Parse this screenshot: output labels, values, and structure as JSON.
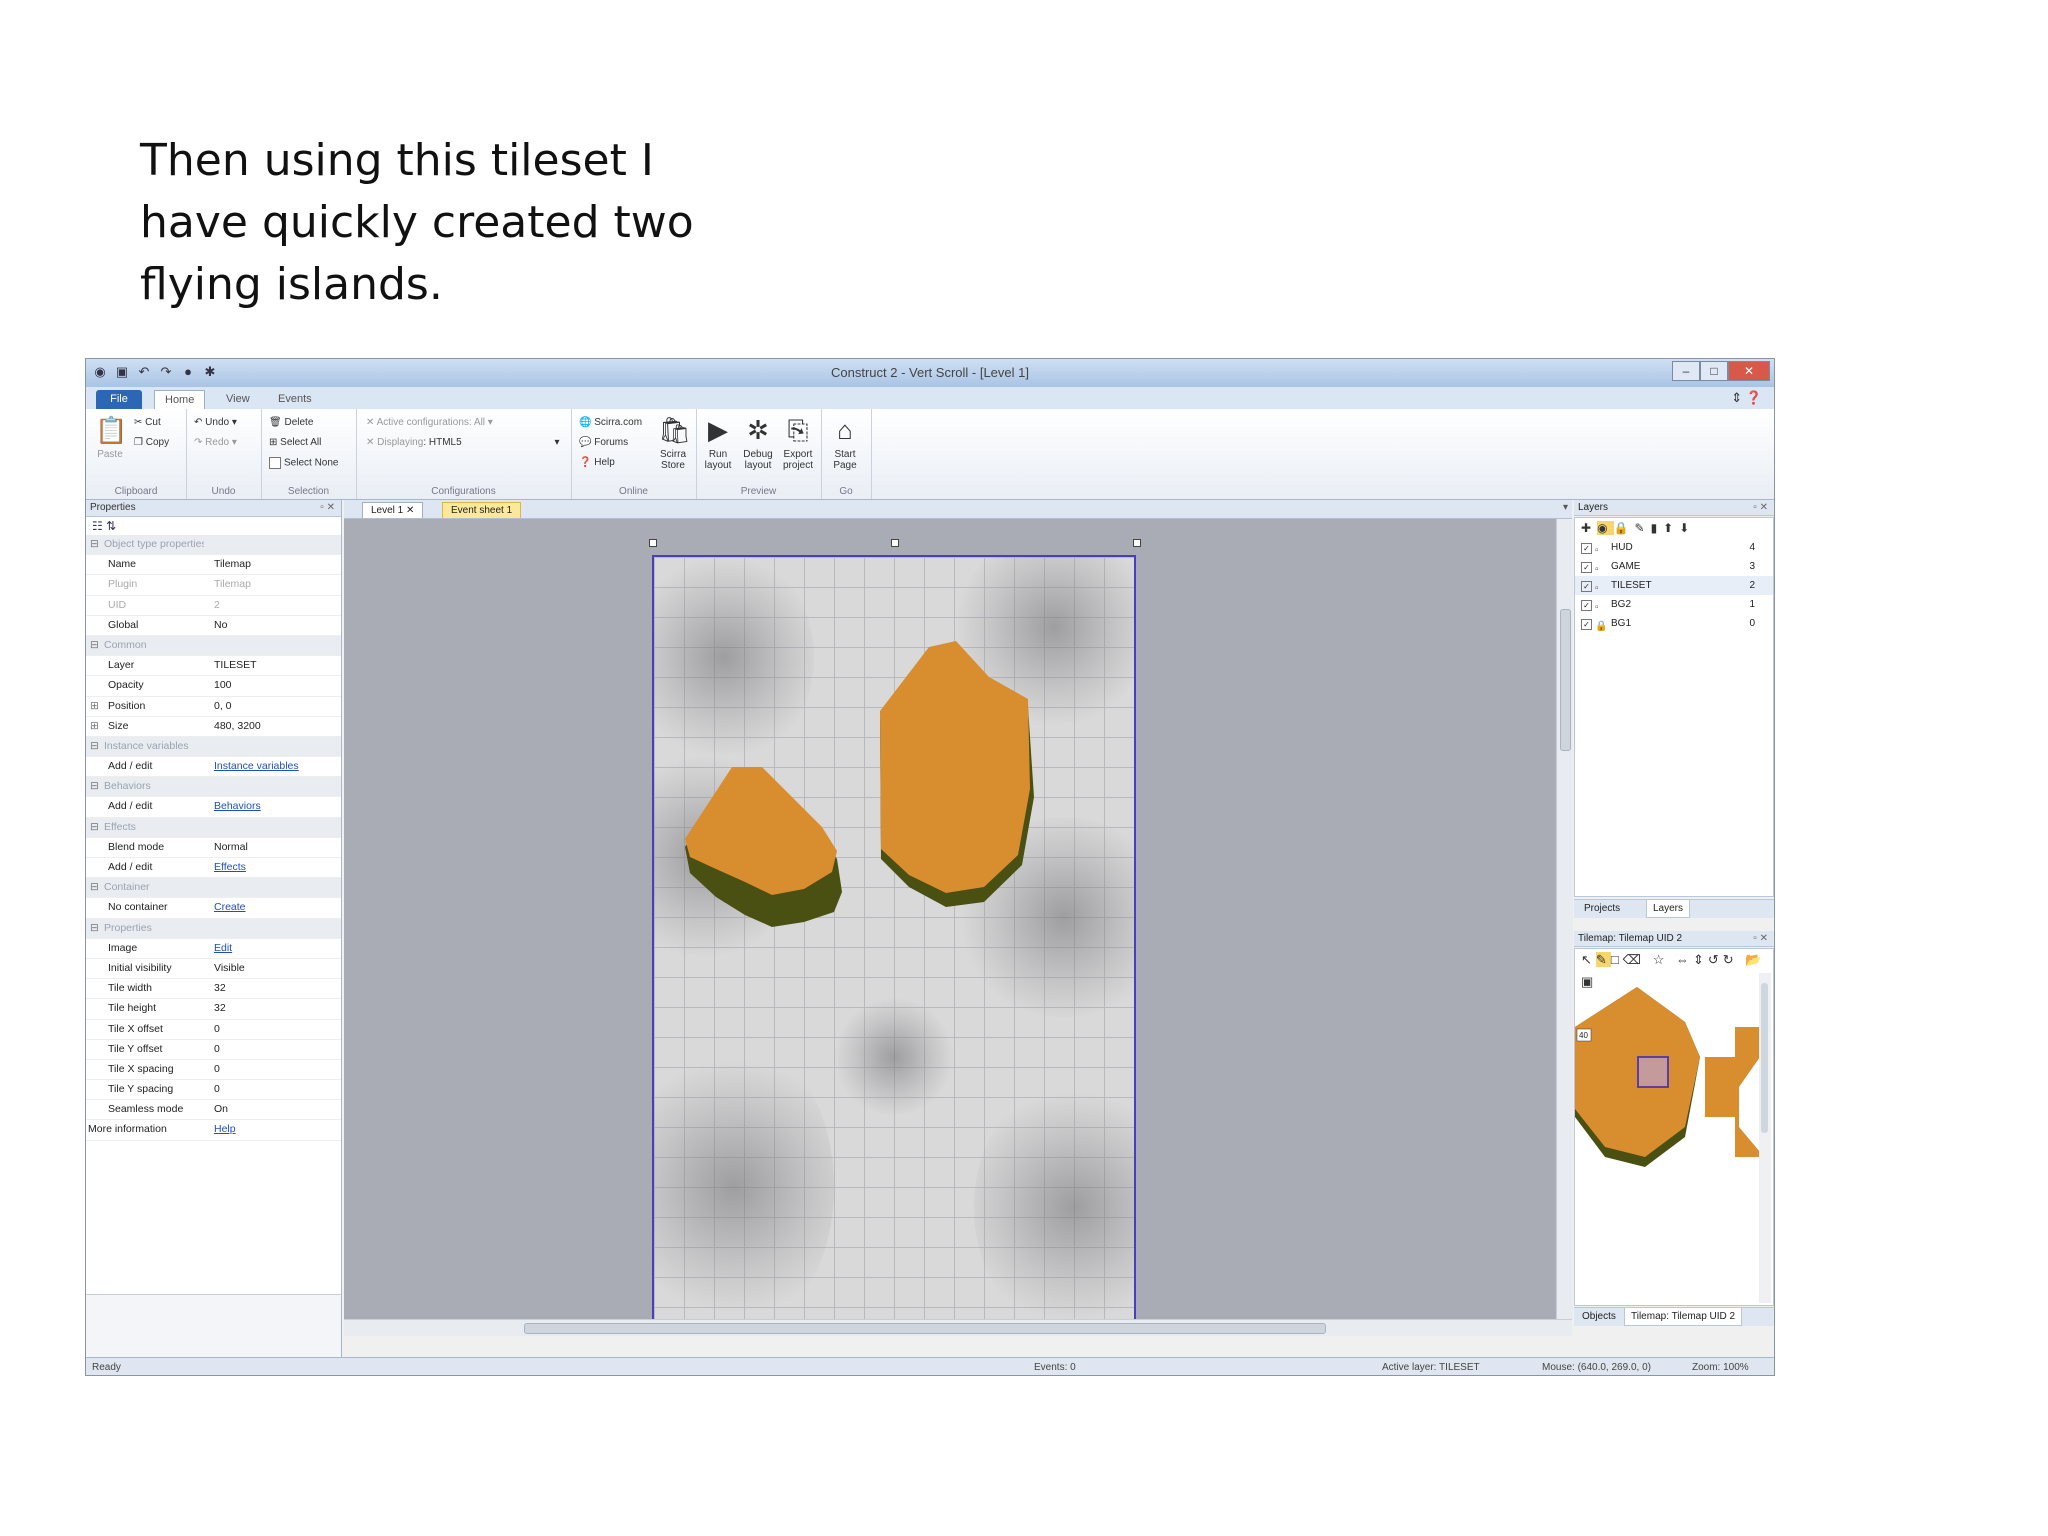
{
  "caption": {
    "line1": "Then using this tileset I",
    "line2": "have quickly created two",
    "line3": "flying islands."
  },
  "window": {
    "title": "Construct 2 - Vert Scroll - [Level 1]"
  },
  "ribbon_tabs": {
    "file": "File",
    "home": "Home",
    "view": "View",
    "events": "Events"
  },
  "ribbon": {
    "clipboard": {
      "paste": "Paste",
      "cut": "Cut",
      "copy": "Copy",
      "label": "Clipboard"
    },
    "undo": {
      "undo": "Undo",
      "redo": "Redo",
      "label": "Undo"
    },
    "selection": {
      "delete": "Delete",
      "select_all": "Select All",
      "select_none": "Select None",
      "label": "Selection"
    },
    "configurations": {
      "active_label": "Active configurations",
      "active_value": "All",
      "display_label": "Displaying",
      "display_value": "HTML5",
      "label": "Configurations"
    },
    "online": {
      "scirra": "Scirra.com",
      "forums": "Forums",
      "help": "Help",
      "store_line1": "Scirra",
      "store_line2": "Store",
      "label": "Online"
    },
    "preview": {
      "run_line1": "Run",
      "run_line2": "layout",
      "debug_line1": "Debug",
      "debug_line2": "layout",
      "export_line1": "Export",
      "export_line2": "project",
      "label": "Preview"
    },
    "go": {
      "start_line1": "Start",
      "start_line2": "Page",
      "label": "Go"
    }
  },
  "properties": {
    "title": "Properties",
    "rows": [
      {
        "kind": "cat",
        "k": "Object type properties"
      },
      {
        "kind": "row",
        "k": "Name",
        "v": "Tilemap"
      },
      {
        "kind": "dim",
        "k": "Plugin",
        "v": "Tilemap"
      },
      {
        "kind": "dim",
        "k": "UID",
        "v": "2"
      },
      {
        "kind": "row",
        "k": "Global",
        "v": "No"
      },
      {
        "kind": "cat",
        "k": "Common"
      },
      {
        "kind": "row",
        "k": "Layer",
        "v": "TILESET"
      },
      {
        "kind": "row",
        "k": "Opacity",
        "v": "100"
      },
      {
        "kind": "exp",
        "k": "Position",
        "v": "0, 0"
      },
      {
        "kind": "exp",
        "k": "Size",
        "v": "480, 3200"
      },
      {
        "kind": "cat",
        "k": "Instance variables"
      },
      {
        "kind": "link",
        "k": "Add / edit",
        "v": "Instance variables"
      },
      {
        "kind": "cat",
        "k": "Behaviors"
      },
      {
        "kind": "link",
        "k": "Add / edit",
        "v": "Behaviors"
      },
      {
        "kind": "cat",
        "k": "Effects"
      },
      {
        "kind": "row",
        "k": "Blend mode",
        "v": "Normal"
      },
      {
        "kind": "link",
        "k": "Add / edit",
        "v": "Effects"
      },
      {
        "kind": "cat",
        "k": "Container"
      },
      {
        "kind": "link",
        "k": "No container",
        "v": "Create"
      },
      {
        "kind": "cat",
        "k": "Properties"
      },
      {
        "kind": "link",
        "k": "Image",
        "v": "Edit"
      },
      {
        "kind": "row",
        "k": "Initial visibility",
        "v": "Visible"
      },
      {
        "kind": "row",
        "k": "Tile width",
        "v": "32"
      },
      {
        "kind": "row",
        "k": "Tile height",
        "v": "32"
      },
      {
        "kind": "row",
        "k": "Tile X offset",
        "v": "0"
      },
      {
        "kind": "row",
        "k": "Tile Y offset",
        "v": "0"
      },
      {
        "kind": "row",
        "k": "Tile X spacing",
        "v": "0"
      },
      {
        "kind": "row",
        "k": "Tile Y spacing",
        "v": "0"
      },
      {
        "kind": "row",
        "k": "Seamless mode",
        "v": "On"
      },
      {
        "kind": "linktop",
        "k": "More information",
        "v": "Help"
      }
    ]
  },
  "doc_tabs": {
    "layout": "Level 1",
    "events": "Event sheet 1"
  },
  "layers": {
    "title": "Layers",
    "items": [
      {
        "name": "HUD",
        "index": "4"
      },
      {
        "name": "GAME",
        "index": "3"
      },
      {
        "name": "TILESET",
        "index": "2"
      },
      {
        "name": "BG2",
        "index": "1"
      },
      {
        "name": "BG1",
        "index": "0"
      }
    ],
    "tab_projects": "Projects",
    "tab_layers": "Layers"
  },
  "tilemap_bar": {
    "title": "Tilemap: Tilemap UID 2",
    "tile_number": "40"
  },
  "bottom_tabs": {
    "objects": "Objects",
    "tilemap": "Tilemap: Tilemap UID 2"
  },
  "status": {
    "ready": "Ready",
    "events": "Events: 0",
    "active_layer": "Active layer: TILESET",
    "mouse": "Mouse: (640.0, 269.0, 0)",
    "zoom": "Zoom: 100%"
  },
  "colors": {
    "island_fill": "#d88d2f",
    "island_edge": "#5a5a1a",
    "layout_border": "#4a3fb8",
    "canvas_bg": "#a9acb4"
  }
}
